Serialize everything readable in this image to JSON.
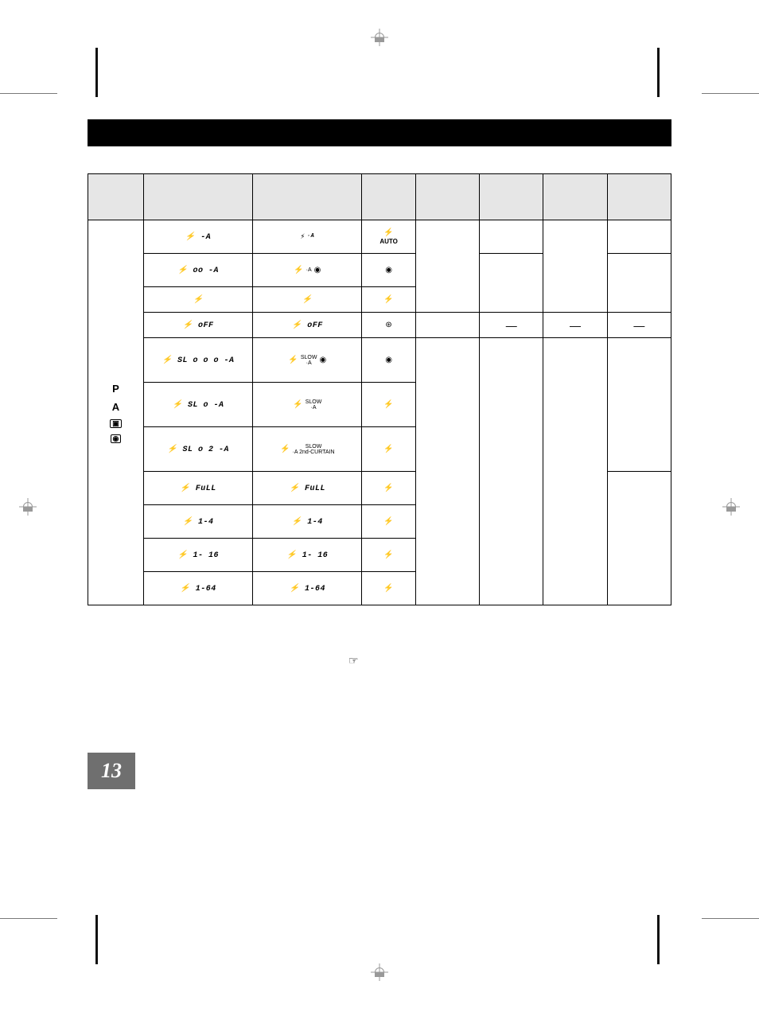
{
  "page_number": "13",
  "glyphs": {
    "bolt": "⚡",
    "eye": "◉",
    "auto": "AUTO",
    "circle_bolt": "⊛",
    "hand": "☞",
    "dash": "—"
  },
  "mode_labels": [
    "P",
    "A"
  ],
  "rows": [
    {
      "lcd": "⚡ -A",
      "vf": "⚡·A",
      "icon": "⚡AUTO",
      "c": [
        "",
        "",
        "",
        ""
      ]
    },
    {
      "lcd": "⚡ oo -A",
      "vf": "⚡·A ◉",
      "icon": "◉",
      "c": [
        "",
        "",
        "",
        ""
      ]
    },
    {
      "lcd": "⚡",
      "vf": "⚡",
      "icon": "⚡",
      "c": [
        "",
        "",
        "",
        ""
      ]
    },
    {
      "lcd": "⚡ oFF",
      "vf": "⚡ oFF",
      "icon": "⊛",
      "c": [
        "",
        "—",
        "—",
        "—"
      ]
    },
    {
      "lcd": "⚡ SL o o o -A",
      "vf": "⚡·A SLOW ◉",
      "icon": "◉",
      "c": [
        "",
        "",
        "",
        ""
      ]
    },
    {
      "lcd": "⚡ SL o -A",
      "vf": "⚡·A SLOW",
      "icon": "⚡",
      "c": [
        "",
        "",
        "",
        ""
      ]
    },
    {
      "lcd": "⚡ SL o 2 -A",
      "vf": "⚡·A SLOW 2nd-CURTAIN",
      "icon": "⚡",
      "c": [
        "",
        "",
        "",
        ""
      ]
    },
    {
      "lcd": "⚡ FuLL",
      "vf": "⚡ FuLL",
      "icon": "⚡",
      "c": [
        "",
        "",
        "",
        ""
      ]
    },
    {
      "lcd": "⚡ 1-4",
      "vf": "⚡ 1-4",
      "icon": "⚡",
      "c": [
        "",
        "",
        "",
        ""
      ]
    },
    {
      "lcd": "⚡ 1- 16",
      "vf": "⚡ 1- 16",
      "icon": "⚡",
      "c": [
        "",
        "",
        "",
        ""
      ]
    },
    {
      "lcd": "⚡ 1-64",
      "vf": "⚡ 1-64",
      "icon": "⚡",
      "c": [
        "",
        "",
        "",
        ""
      ]
    }
  ]
}
